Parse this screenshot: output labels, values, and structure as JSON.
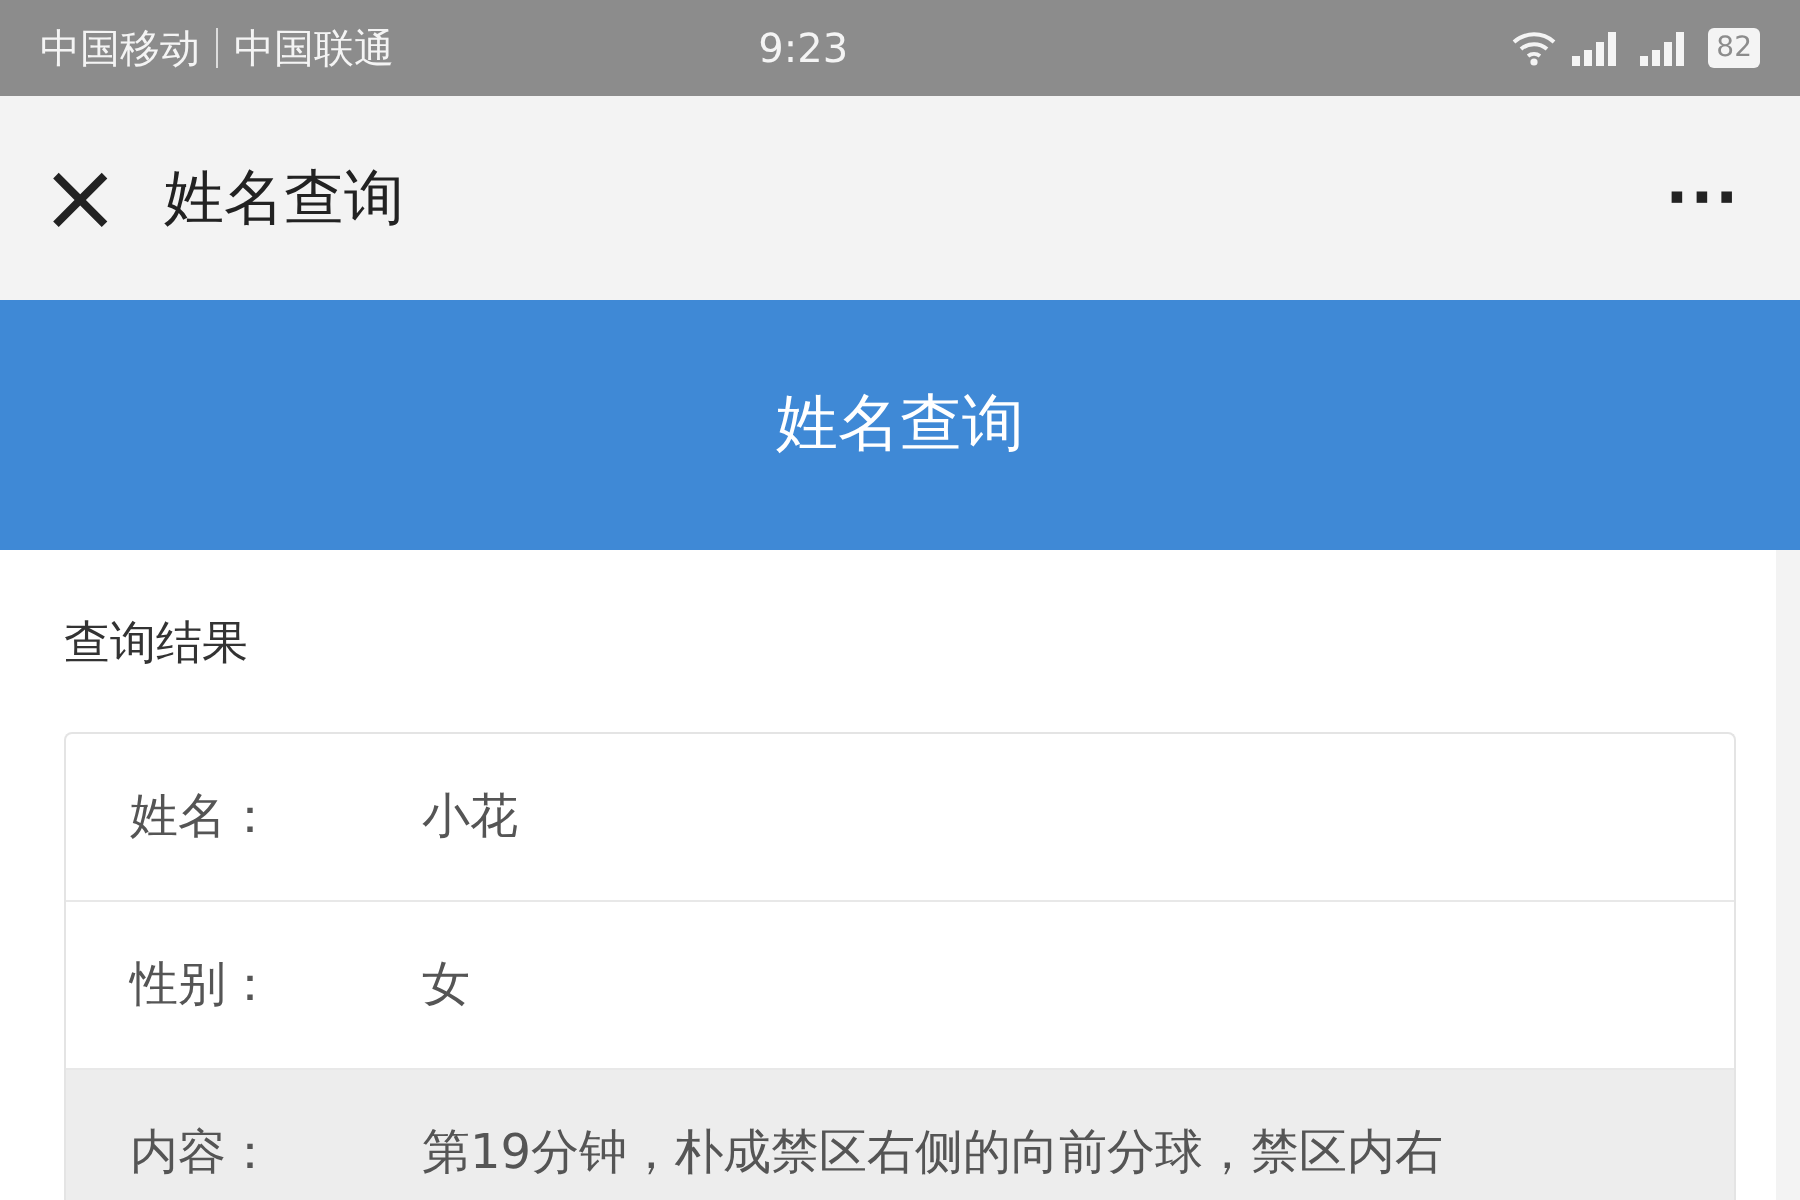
{
  "status_bar": {
    "carriers": [
      "中国移动",
      "中国联通"
    ],
    "time": "9:23",
    "battery": "82"
  },
  "nav_bar": {
    "close": "×",
    "title": "姓名查询",
    "more": "···"
  },
  "header": {
    "title": "姓名查询"
  },
  "result": {
    "heading": "查询结果",
    "rows": [
      {
        "label": "姓名：",
        "value": "小花",
        "shaded": false
      },
      {
        "label": "性别：",
        "value": "女",
        "shaded": false
      },
      {
        "label": "内容：",
        "value": "第19分钟，朴成禁区右侧的向前分球，禁区内右",
        "shaded": true
      }
    ]
  }
}
